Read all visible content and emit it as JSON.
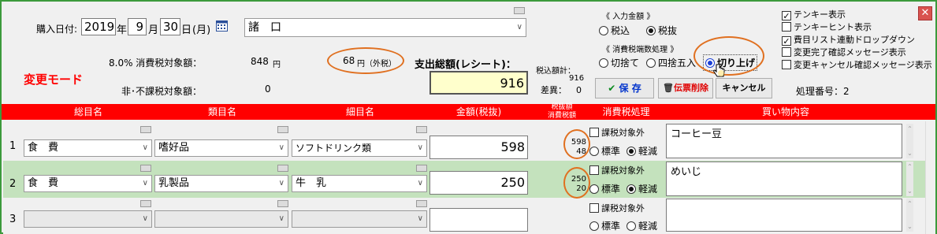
{
  "header": {
    "date_label": "購入日付:",
    "year": "2019",
    "year_unit": "年",
    "month": "9",
    "month_unit": "月",
    "day": "30",
    "day_unit": "日",
    "weekday": "(月)",
    "store": "諸　口",
    "mode_label": "変更モード",
    "taxable_label": "8.0% 消費税対象額：",
    "taxable_value": "848",
    "taxable_unit": "円",
    "tax_value": "68",
    "tax_unit": "円（外税）",
    "nontaxable_label": "非･不課税対象額：",
    "nontaxable_value": "0",
    "total_label": "支出総額(レシート)：",
    "total_value": "916",
    "incl_label": "税込額計：",
    "incl_value": "916",
    "diff_label": "差異：",
    "diff_value": "0"
  },
  "input_group": {
    "title": "《 入力金額 》",
    "options": [
      "税込",
      "税抜"
    ],
    "selected": "税抜"
  },
  "rounding_group": {
    "title": "《 消費税端数処理 》",
    "options": [
      "切捨て",
      "四捨五入",
      "切り上げ"
    ],
    "selected": "切り上げ"
  },
  "buttons": {
    "save": "保 存",
    "delete": "伝票削除",
    "cancel": "キャンセル"
  },
  "process_no": "処理番号：2",
  "options": [
    {
      "label": "テンキー表示",
      "checked": true
    },
    {
      "label": "テンキーヒント表示",
      "checked": false
    },
    {
      "label": "費目リスト連動ドロップダウン",
      "checked": true
    },
    {
      "label": "変更完了確認メッセージ表示",
      "checked": false
    },
    {
      "label": "変更キャンセル確認メッセージ表示",
      "checked": false
    }
  ],
  "columns": {
    "main": "総目名",
    "cat": "類目名",
    "sub": "細目名",
    "amount": "金額(税抜)",
    "taxcol1": "税抜額",
    "taxcol2": "消費税額",
    "taxproc": "消費税処理",
    "content": "買い物内容"
  },
  "row_labels": {
    "exempt": "課税対象外",
    "standard": "標準",
    "reduced": "軽減"
  },
  "rows": [
    {
      "no": "1",
      "main": "食　費",
      "cat": "嗜好品",
      "sub": "ソフトドリンク類",
      "amount": "598",
      "taxex": "598",
      "tax": "48",
      "content": "コーヒー豆"
    },
    {
      "no": "2",
      "main": "食　費",
      "cat": "乳製品",
      "sub": "牛　乳",
      "amount": "250",
      "taxex": "250",
      "tax": "20",
      "content": "めいじ"
    },
    {
      "no": "3",
      "main": "",
      "cat": "",
      "sub": "",
      "amount": "",
      "taxex": "",
      "tax": "",
      "content": ""
    }
  ],
  "colors": {
    "accent_red": "#ff0000",
    "highlight_row": "#c4e2bd",
    "annotation": "#e07020",
    "date_highlight": "#ffffcc"
  }
}
